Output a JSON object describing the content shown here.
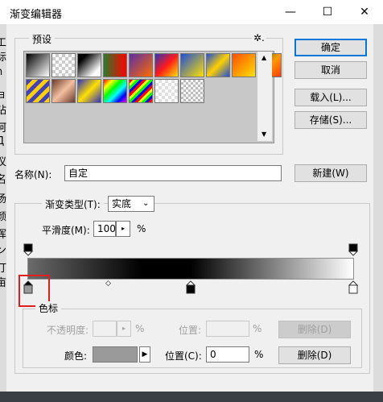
{
  "window": {
    "title": "渐变编辑器",
    "min_glyph": "—",
    "max_glyph": "☐",
    "close_glyph": "✕"
  },
  "background_edge": [
    "工",
    "标",
    "h",
    "ョ",
    "钻",
    "呵",
    "Д",
    "议",
    "名",
    "汤",
    "颜",
    "晖",
    "ン",
    "汀",
    "亩"
  ],
  "presets": {
    "label": "预设",
    "gear_glyph": "✲.",
    "swatches": [
      {
        "bg": "linear-gradient(135deg,#000 0%,#fff 100%)"
      },
      {
        "bg": "repeating-conic-gradient(#ccc 0% 25%,#fff 0% 50%) 0 0/8px 8px"
      },
      {
        "bg": "linear-gradient(135deg,#000 20%,#fff 80%)"
      },
      {
        "bg": "linear-gradient(to right,#2a7a2a,#ff0000)"
      },
      {
        "bg": "linear-gradient(135deg,#5a2ea6,#ff6a00)"
      },
      {
        "bg": "linear-gradient(135deg,#2d33b8,#ff1a1a,#ffe000)"
      },
      {
        "bg": "linear-gradient(135deg,#1e4fd8,#ffe000)"
      },
      {
        "bg": "linear-gradient(135deg,#1e4fd8,#ffd000,#1e4fd8)"
      },
      {
        "bg": "linear-gradient(135deg,#ff4e00,#ffe000)"
      },
      {
        "bg": "linear-gradient(135deg,#2a6a2a,#ff9a00,#ff3a00)"
      },
      {
        "bg": "repeating-linear-gradient(135deg,#4040c0 0 5px,#ffd000 5px 10px)"
      },
      {
        "bg": "linear-gradient(135deg,#6b3a2a,#f3c0a0,#6b3a2a)"
      },
      {
        "bg": "linear-gradient(135deg,#3030c0,#ffe000,#3030c0)"
      },
      {
        "bg": "linear-gradient(135deg,#ff0000,#ffff00,#00ff00,#00ffff,#0000ff,#ff00ff)"
      },
      {
        "bg": "repeating-linear-gradient(135deg,#ff0000 0 3px,#ffff00 3px 6px,#00ff00 6px 9px,#0000ff 9px 12px)"
      },
      {
        "bg": "repeating-conic-gradient(#e0e0e0 0% 25%,#fff 0% 50%) 0 0/8px 8px"
      },
      {
        "bg": "repeating-conic-gradient(#bdbdbd 0% 25%,#f5f5f5 0% 50%) 0 0/6px 6px"
      }
    ]
  },
  "buttons": {
    "ok": "确定",
    "cancel": "取消",
    "load": "载入(L)...",
    "save": "存储(S)...",
    "new": "新建(W)",
    "delete_opacity": "删除(D)",
    "delete_color": "删除(D)"
  },
  "name_field": {
    "label": "名称(N):",
    "value": "自定"
  },
  "gradient_type": {
    "label": "渐变类型(T):",
    "value": "实底"
  },
  "smoothness": {
    "label": "平滑度(M):",
    "value": "100",
    "unit": "%"
  },
  "stops_section": {
    "label": "色标",
    "opacity_label": "不透明度:",
    "opacity_value": "",
    "opacity_unit": "%",
    "opacity_location_label": "位置:",
    "opacity_location_value": "",
    "opacity_location_unit": "%",
    "color_label": "颜色:",
    "swatch_color": "#9a9a9a",
    "color_location_label": "位置(C):",
    "color_location_value": "0",
    "color_location_unit": "%"
  },
  "gradient": {
    "stops": [
      "#6b6b6b",
      "#000000",
      "#000000",
      "#ffffff"
    ]
  }
}
